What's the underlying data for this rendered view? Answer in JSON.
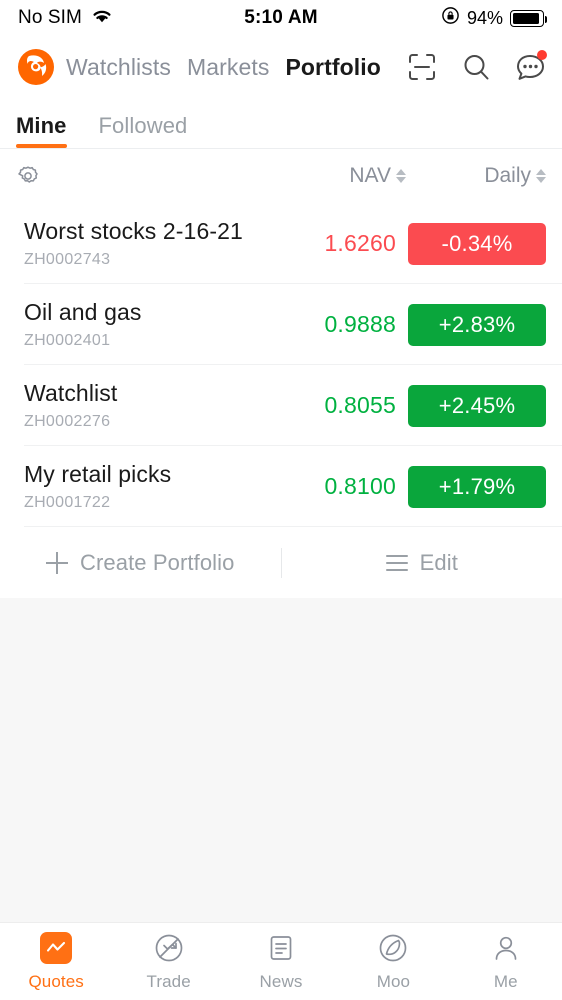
{
  "status_bar": {
    "carrier": "No SIM",
    "wifi_icon": "wifi-icon",
    "time": "5:10 AM",
    "rotation_lock_icon": "rotation-lock-icon",
    "battery_percent": "94%",
    "battery_icon": "battery-icon"
  },
  "header": {
    "logo_icon": "moomoo-logo-icon",
    "nav": [
      {
        "label": "Watchlists",
        "active": false
      },
      {
        "label": "Markets",
        "active": false
      },
      {
        "label": "Portfolio",
        "active": true
      }
    ],
    "icons": [
      {
        "name": "scan-icon",
        "badge": false
      },
      {
        "name": "search-icon",
        "badge": false
      },
      {
        "name": "chat-dots-icon",
        "badge": true
      }
    ],
    "badge_color": "#ff3b30"
  },
  "tabs": [
    {
      "label": "Mine",
      "active": true
    },
    {
      "label": "Followed",
      "active": false
    }
  ],
  "column_header": {
    "settings_icon": "gear-icon",
    "nav_label": "NAV",
    "daily_label": "Daily",
    "sort_icon": "sort-arrows-icon"
  },
  "portfolios": [
    {
      "name": "Worst stocks 2-16-21",
      "code": "ZH0002743",
      "nav": "1.6260",
      "daily": "-0.34%",
      "direction": "down"
    },
    {
      "name": "Oil and gas",
      "code": "ZH0002401",
      "nav": "0.9888",
      "daily": "+2.83%",
      "direction": "up"
    },
    {
      "name": "Watchlist",
      "code": "ZH0002276",
      "nav": "0.8055",
      "daily": "+2.45%",
      "direction": "up"
    },
    {
      "name": "My retail picks",
      "code": "ZH0001722",
      "nav": "0.8100",
      "daily": "+1.79%",
      "direction": "up"
    }
  ],
  "actions": {
    "create_label": "Create Portfolio",
    "create_icon": "plus-icon",
    "edit_label": "Edit",
    "edit_icon": "hamburger-icon"
  },
  "bottom_bar": [
    {
      "label": "Quotes",
      "icon": "quotes-icon",
      "active": true
    },
    {
      "label": "Trade",
      "icon": "trade-icon",
      "active": false
    },
    {
      "label": "News",
      "icon": "news-icon",
      "active": false
    },
    {
      "label": "Moo",
      "icon": "moon-icon",
      "active": false
    },
    {
      "label": "Me",
      "icon": "person-icon",
      "active": false
    }
  ],
  "colors": {
    "accent": "#ff7014",
    "up": "#00b140",
    "up_badge": "#0aa63c",
    "down": "#fb4b50",
    "muted": "#9aa0a6",
    "background": "#f7f7f7"
  }
}
